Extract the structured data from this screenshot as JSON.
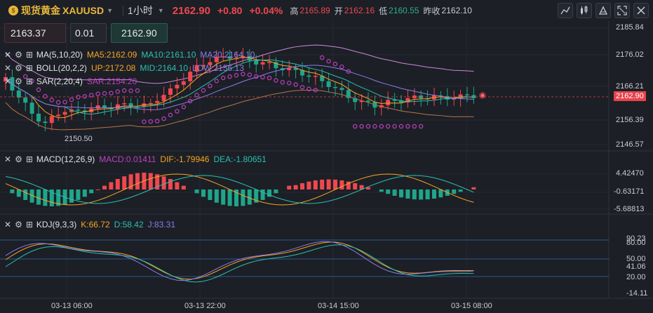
{
  "header": {
    "coin_glyph": "$",
    "symbol_name": "现货黄金",
    "symbol_code": "XAUUSD",
    "period": "1小时",
    "last_price": "2162.90",
    "change": "+0.80",
    "change_pct": "+0.04%",
    "high_label": "高",
    "high": "2165.89",
    "open_label": "开",
    "open": "2162.16",
    "low_label": "低",
    "low": "2160.55",
    "prev_label": "昨收",
    "prev": "2162.10",
    "icons": [
      "line-tool-icon",
      "chart-type-icon",
      "indicator-icon",
      "fullscreen-icon",
      "close-icon"
    ]
  },
  "trade": {
    "sell_price": "2163.37",
    "quantity": "0.01",
    "buy_price": "2162.90"
  },
  "main_legend": {
    "ma": {
      "name": "MA(5,10,20)",
      "ma5": "MA5:2162.09",
      "ma10": "MA10:2161.10",
      "ma20": "MA20:2164.10"
    },
    "boll": {
      "name": "BOLL(20,2,2)",
      "up": "UP:2172.08",
      "mid": "MID:2164.10",
      "low": "LOW:2156.13"
    },
    "sar": {
      "name": "SAR(2,20,4)",
      "sar": "SAR:2154.20"
    }
  },
  "main_axis": {
    "ticks": [
      "2185.84",
      "2176.02",
      "2166.21",
      "2156.39",
      "2146.57"
    ],
    "current": "2162.90",
    "annotation_low": "2150.50"
  },
  "macd": {
    "name": "MACD(12,26,9)",
    "macd": "MACD:0.01411",
    "dif": "DIF:-1.79946",
    "dea": "DEA:-1.80651",
    "ticks": [
      "4.42470",
      "-0.63171",
      "-5.68813"
    ]
  },
  "kdj": {
    "name": "KDJ(9,3,3)",
    "k": "K:66.72",
    "d": "D:58.42",
    "j": "J:83.31",
    "ticks": [
      "90.23",
      "80.00",
      "50.00",
      "41.06",
      "20.00",
      "-14.11"
    ]
  },
  "time_axis": [
    "03-13 06:00",
    "03-13 22:00",
    "03-14 15:00",
    "03-15 08:00"
  ],
  "colors": {
    "up": "#f0474e",
    "down": "#1fa58a",
    "ma5": "#f5a623",
    "ma10": "#29c0b0",
    "ma20": "#8a7de8",
    "boll": "#c98ad8",
    "sar": "#c040c0"
  }
}
